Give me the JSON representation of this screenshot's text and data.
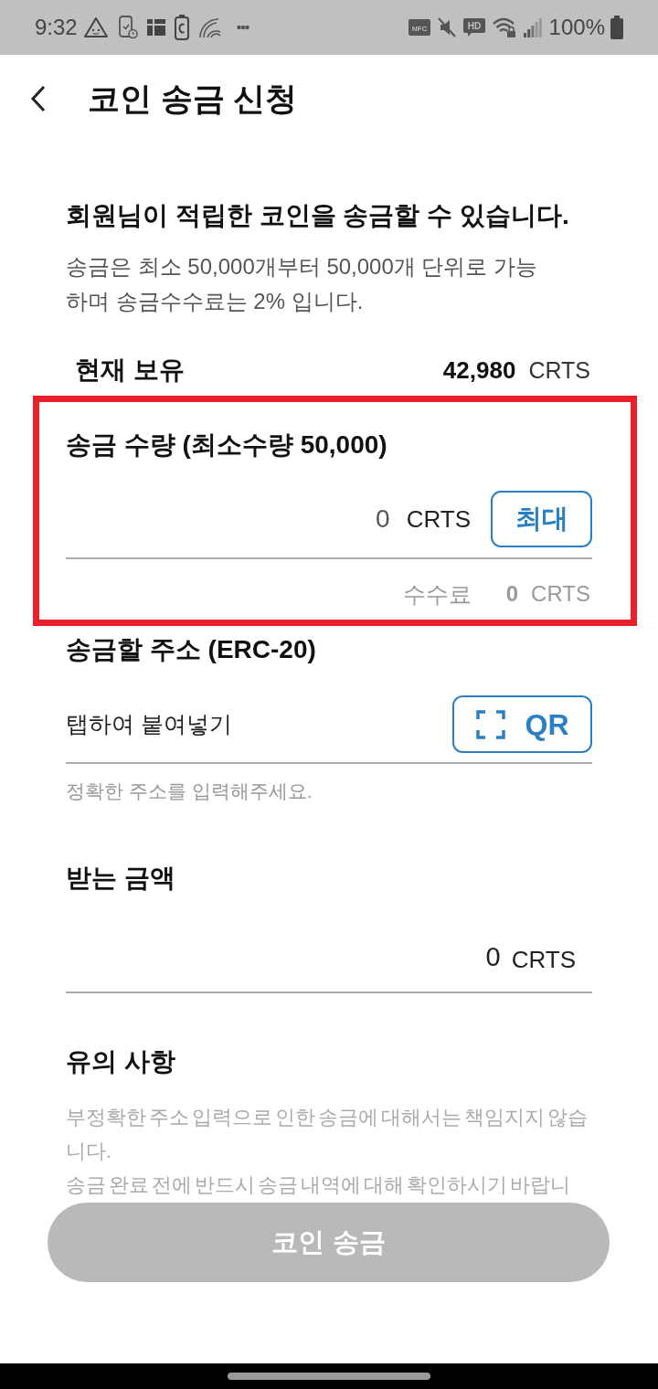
{
  "status_bar": {
    "time": "9:32",
    "left_icons": [
      {
        "kind": "warning-face"
      },
      {
        "kind": "phone-clock"
      },
      {
        "kind": "tiles"
      },
      {
        "kind": "battery-c"
      },
      {
        "kind": "arcs"
      },
      {
        "kind": "dots"
      }
    ],
    "right_icons": [
      {
        "kind": "nfc",
        "label": "NFC"
      },
      {
        "kind": "mute"
      },
      {
        "kind": "hd",
        "label": "HD"
      },
      {
        "kind": "wifi-lock"
      },
      {
        "kind": "signal"
      }
    ],
    "battery_text": "100%"
  },
  "header": {
    "title": "코인 송금 신청"
  },
  "intro": {
    "headline": "회원님이 적립한 코인을 송금할 수 있습니다.",
    "description": "송금은 최소 50,000개부터 50,000개 단위로 가능하며 송금수수료는 2% 입니다."
  },
  "balance": {
    "label": "현재 보유",
    "amount": "42,980",
    "unit": "CRTS"
  },
  "amount_section": {
    "highlighted": true,
    "title": "송금 수량 (최소수량 50,000)",
    "placeholder": "0",
    "unit": "CRTS",
    "max_button": "최대",
    "fee_label": "수수료",
    "fee_amount": "0",
    "fee_unit": "CRTS"
  },
  "address_section": {
    "title": "송금할 주소 (ERC-20)",
    "placeholder": "탭하여 붙여넣기",
    "qr_button": "QR",
    "hint": "정확한 주소를 입력해주세요."
  },
  "received": {
    "title": "받는 금액",
    "amount": "0",
    "unit": "CRTS"
  },
  "notice": {
    "title": "유의 사항",
    "paragraphs": [
      "부정확한 주소 입력으로 인한 송금에 대해서는 책임지지 않습니다.",
      "송금 완료 전에 반드시 송금 내역에 대해 확인하시기 바랍니"
    ]
  },
  "submit_button": {
    "label": "코인 송금",
    "disabled": true
  }
}
